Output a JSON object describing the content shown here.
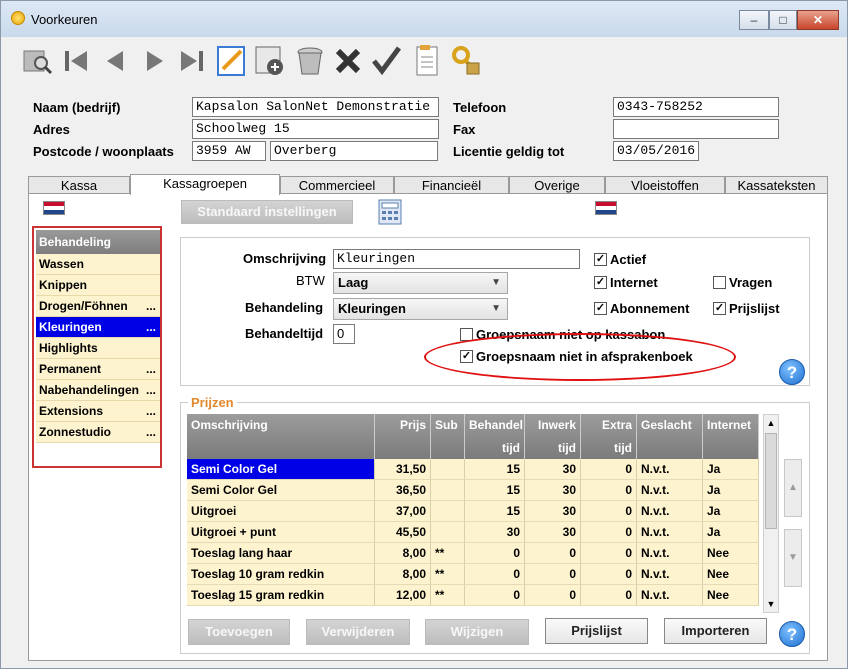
{
  "window": {
    "title": "Voorkeuren",
    "min": "–",
    "max": "□",
    "close": "✕"
  },
  "toolbar": [
    "search-icon",
    "first-icon",
    "previous-icon",
    "next-icon",
    "last-icon",
    "edit-icon",
    "add-record-icon",
    "trash-icon",
    "cancel-icon",
    "confirm-icon",
    "report-icon",
    "key-lock-icon"
  ],
  "header": {
    "name_label": "Naam (bedrijf)",
    "name_value": "Kapsalon SalonNet Demonstratie",
    "adres_label": "Adres",
    "adres_value": "Schoolweg 15",
    "postcode_label": "Postcode / woonplaats",
    "postcode_value": "3959 AW",
    "plaats_value": "Overberg",
    "telefoon_label": "Telefoon",
    "telefoon_value": "0343-758252",
    "fax_label": "Fax",
    "fax_value": "",
    "licentie_label": "Licentie geldig tot",
    "licentie_value": "03/05/2016"
  },
  "tabs": [
    "Kassa",
    "Kassagroepen",
    "Commercieel",
    "Financieël",
    "Overige",
    "Vloeistoffen",
    "Kassateksten"
  ],
  "active_tab": "Kassagroepen",
  "standaard_button": "Standaard instellingen",
  "grouplist": {
    "header": "Behandeling",
    "items": [
      {
        "label": "Wassen",
        "dots": ""
      },
      {
        "label": "Knippen",
        "dots": ""
      },
      {
        "label": "Drogen/Föhnen",
        "dots": "..."
      },
      {
        "label": "Kleuringen",
        "dots": "..."
      },
      {
        "label": "Highlights",
        "dots": ""
      },
      {
        "label": "Permanent",
        "dots": "..."
      },
      {
        "label": "Nabehandelingen",
        "dots": "..."
      },
      {
        "label": "Extensions",
        "dots": "..."
      },
      {
        "label": "Zonnestudio",
        "dots": "..."
      }
    ],
    "selected": "Kleuringen"
  },
  "form": {
    "omschrijving_label": "Omschrijving",
    "omschrijving_value": "Kleuringen",
    "btw_label": "BTW",
    "btw_value": "Laag",
    "behandeling_label": "Behandeling",
    "behandeling_value": "Kleuringen",
    "behandeltijd_label": "Behandeltijd",
    "behandeltijd_value": "0",
    "actief": "Actief",
    "internet": "Internet",
    "vragen": "Vragen",
    "abonnement": "Abonnement",
    "prijslijst": "Prijslijst",
    "groep_kassabon": "Groepsnaam niet op kassabon",
    "groep_afsprakenboek": "Groepsnaam niet in afsprakenboek",
    "checked": {
      "actief": true,
      "internet": true,
      "vragen": false,
      "abonnement": true,
      "prijslijst": true,
      "groep_kassabon": false,
      "groep_afsprakenboek": true
    }
  },
  "prijzen": {
    "legend": "Prijzen",
    "columns": [
      {
        "l1": "Omschrijving",
        "l2": ""
      },
      {
        "l1": "Prijs",
        "l2": ""
      },
      {
        "l1": "Sub",
        "l2": ""
      },
      {
        "l1": "Behandel",
        "l2": "tijd"
      },
      {
        "l1": "Inwerk",
        "l2": "tijd"
      },
      {
        "l1": "Extra",
        "l2": "tijd"
      },
      {
        "l1": "Geslacht",
        "l2": ""
      },
      {
        "l1": "Internet",
        "l2": ""
      }
    ],
    "rows": [
      [
        "Semi Color Gel",
        "31,50",
        "",
        "15",
        "30",
        "0",
        "N.v.t.",
        "Ja"
      ],
      [
        "Semi Color Gel",
        "36,50",
        "",
        "15",
        "30",
        "0",
        "N.v.t.",
        "Ja"
      ],
      [
        "Uitgroei",
        "37,00",
        "",
        "15",
        "30",
        "0",
        "N.v.t.",
        "Ja"
      ],
      [
        "Uitgroei + punt",
        "45,50",
        "",
        "30",
        "30",
        "0",
        "N.v.t.",
        "Ja"
      ],
      [
        "Toeslag lang haar",
        "8,00",
        "**",
        "0",
        "0",
        "0",
        "N.v.t.",
        "Nee"
      ],
      [
        "Toeslag 10 gram redkin",
        "8,00",
        "**",
        "0",
        "0",
        "0",
        "N.v.t.",
        "Nee"
      ],
      [
        "Toeslag 15 gram redkin",
        "12,00",
        "**",
        "0",
        "0",
        "0",
        "N.v.t.",
        "Nee"
      ]
    ],
    "buttons": {
      "toevoegen": "Toevoegen",
      "verwijderen": "Verwijderen",
      "wijzigen": "Wijzigen",
      "prijslijst": "Prijslijst",
      "importeren": "Importeren"
    }
  },
  "help": "?",
  "colors": {
    "selection": "#0000e6",
    "row_bg": "#fdf3cf",
    "highlight_oval": "#e01010",
    "legend": "#e0892d"
  }
}
